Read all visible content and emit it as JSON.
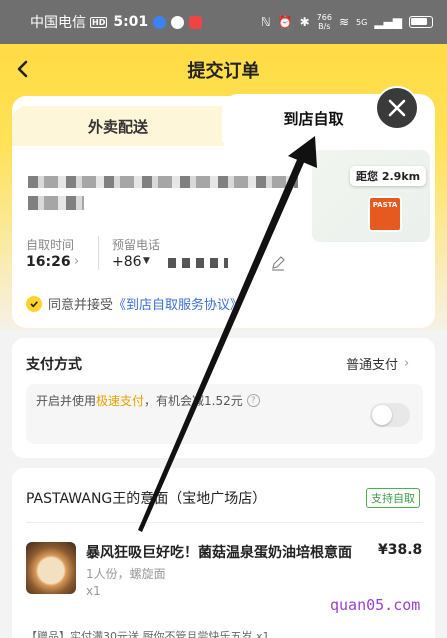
{
  "status_bar": {
    "carrier": "中国电信",
    "hd": "HD",
    "time": "5:01",
    "net_speed_value": "766",
    "net_speed_unit": "B/s",
    "signal": "5G"
  },
  "header": {
    "title": "提交订单"
  },
  "tabs": [
    {
      "label": "外卖配送",
      "active": false
    },
    {
      "label": "到店自取",
      "active": true
    }
  ],
  "pickup": {
    "distance": "距您 2.9km",
    "store_logo_text": "PASTA",
    "time_label": "自取时间",
    "time_value": "16:26",
    "phone_label": "预留电话",
    "phone_prefix": "+86"
  },
  "agreement": {
    "text": "同意并接受",
    "link": "《到店自取服务协议》"
  },
  "payment": {
    "title": "支付方式",
    "method": "普通支付",
    "tip_prefix": "开启并使用",
    "tip_highlight": "极速支付",
    "tip_suffix": "，有机会减1.52元"
  },
  "store": {
    "name": "PASTAWANG王的意面（宝地广场店）",
    "badge": "支持自取"
  },
  "item": {
    "name": "暴风狂吸巨好吃！菌菇温泉蛋奶油培根意面",
    "price": "¥38.8",
    "spec": "1人份，螺旋面",
    "qty": "x1"
  },
  "promo": "【赠品】实付满30元送 厨你不管且尝快乐五岁 x1",
  "watermark": "quan05.com",
  "colors": {
    "brand_yellow": "#ffd93b",
    "link_blue": "#3a6fd8",
    "highlight": "#e6a100"
  }
}
